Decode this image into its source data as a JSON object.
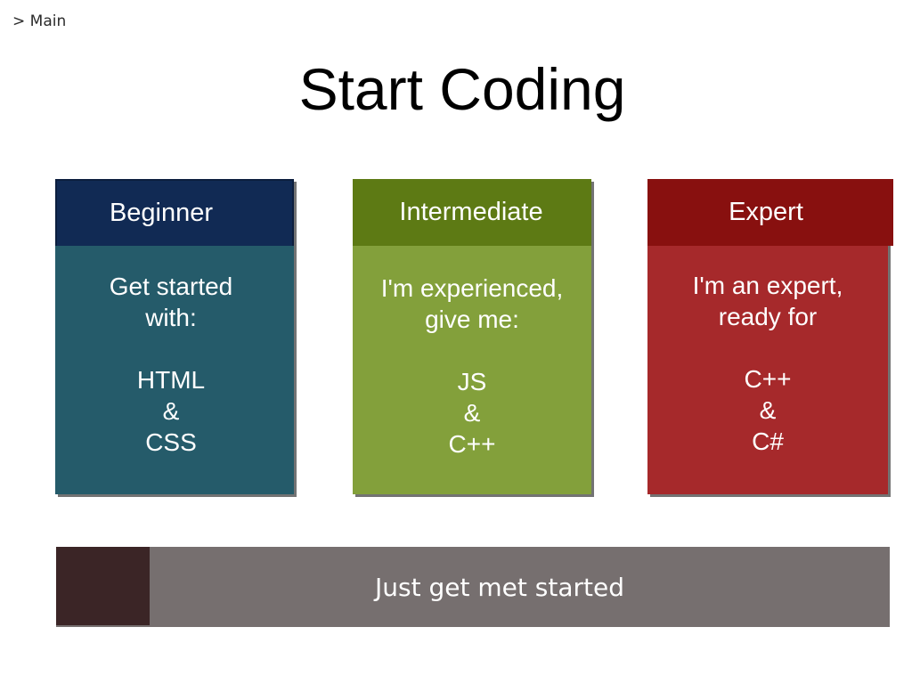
{
  "breadcrumb": {
    "text": "> Main"
  },
  "title": "Start Coding",
  "cards": [
    {
      "heading": "Beginner",
      "intro_1": "Get started",
      "intro_2": "with:",
      "lang_1": "HTML",
      "joiner": "&",
      "lang_2": "CSS",
      "head_color": "#112a54",
      "body_color": "#255b6a"
    },
    {
      "heading": "Intermediate",
      "intro_1": "I'm experienced,",
      "intro_2": "give me:",
      "lang_1": "JS",
      "joiner": "&",
      "lang_2": "C++",
      "head_color": "#5d7a14",
      "body_color": "#83a03b"
    },
    {
      "heading": "Expert",
      "intro_1": "I'm an expert,",
      "intro_2": "ready for",
      "lang_1": "C++",
      "joiner": "&",
      "lang_2": "C#",
      "head_color": "#88100f",
      "body_color": "#a6292b"
    }
  ],
  "cta": {
    "label": "Just get met started",
    "color": "#766f6f",
    "accent": "#3b2526"
  }
}
